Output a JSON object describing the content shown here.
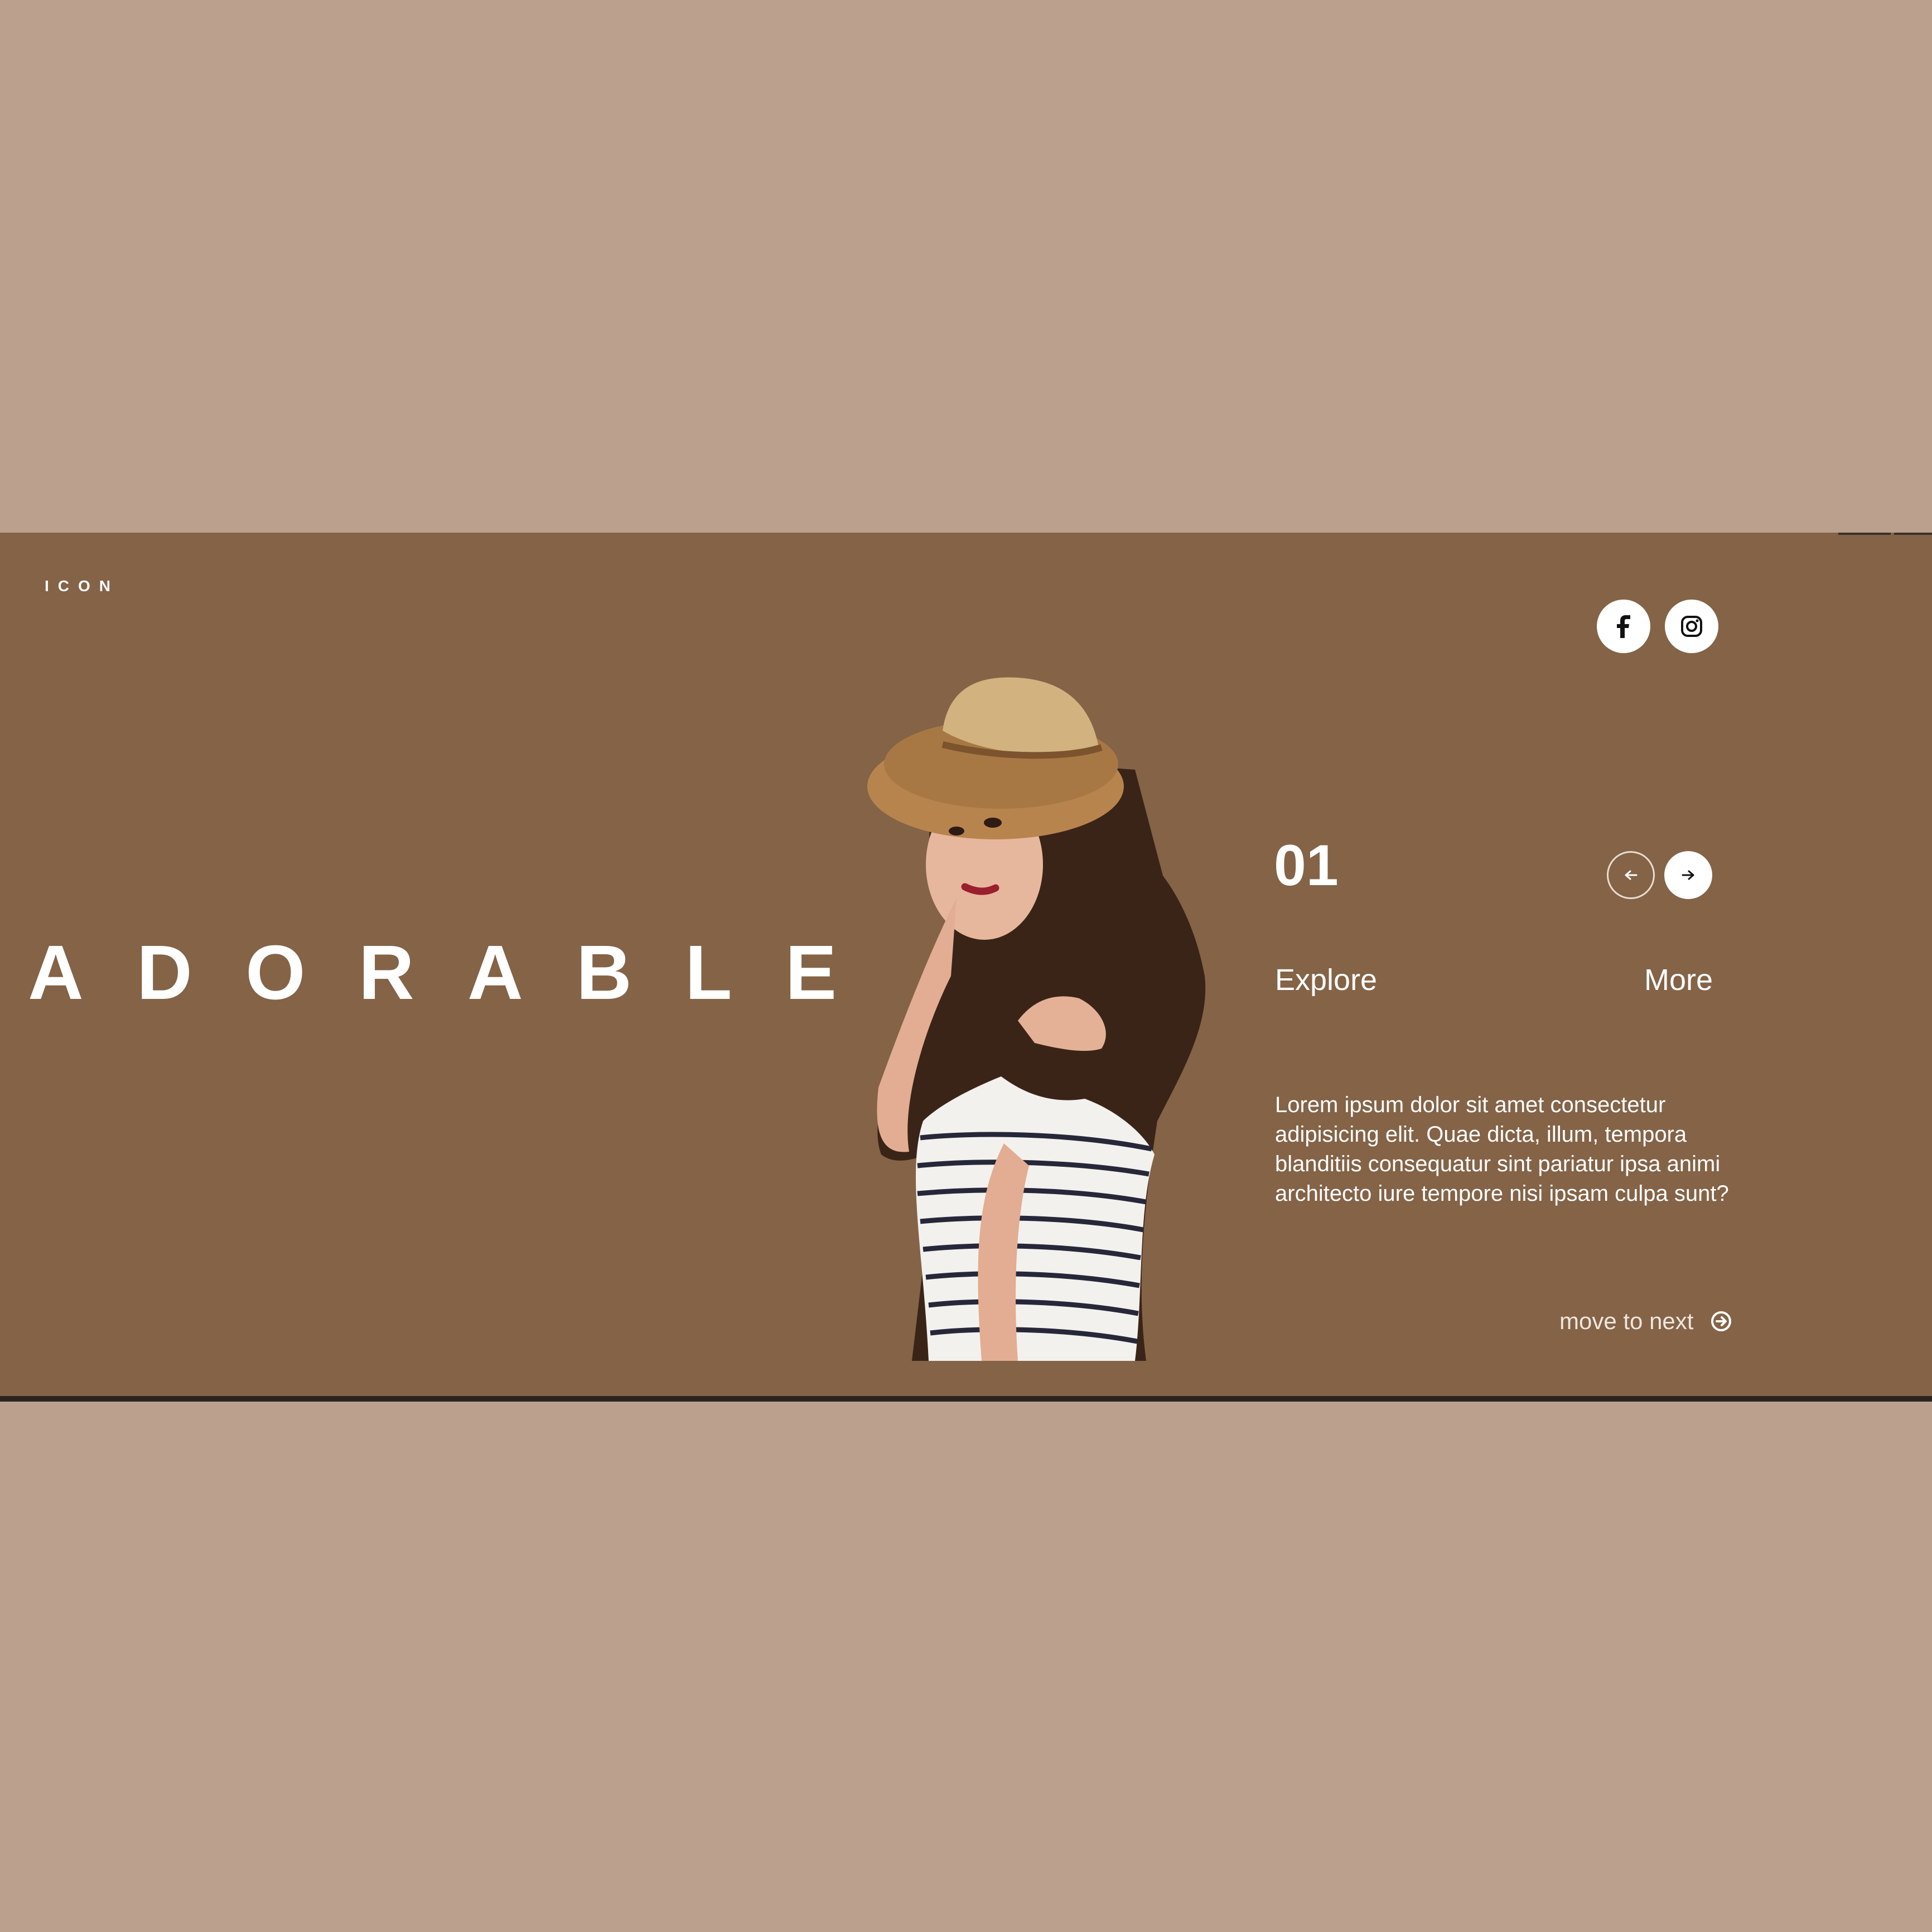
{
  "brand": {
    "logo": "ICON"
  },
  "hero": {
    "title_letters": [
      "A",
      "D",
      "O",
      "R",
      "A",
      "B",
      "L",
      "E"
    ],
    "counter": "01",
    "explore_label": "Explore",
    "more_label": "More",
    "description": "Lorem ipsum dolor sit amet consectetur adipisicing elit. Quae dicta, illum, tempora blanditiis consequatur sint pariatur ipsa animi architecto iure tempore nisi ipsam culpa sunt?",
    "move_next_label": "move to next"
  },
  "social": [
    {
      "icon": "facebook-icon"
    },
    {
      "icon": "instagram-icon"
    }
  ],
  "colors": {
    "page_background": "#baa08d",
    "hero_background": "#846347",
    "text": "#ffffff"
  }
}
